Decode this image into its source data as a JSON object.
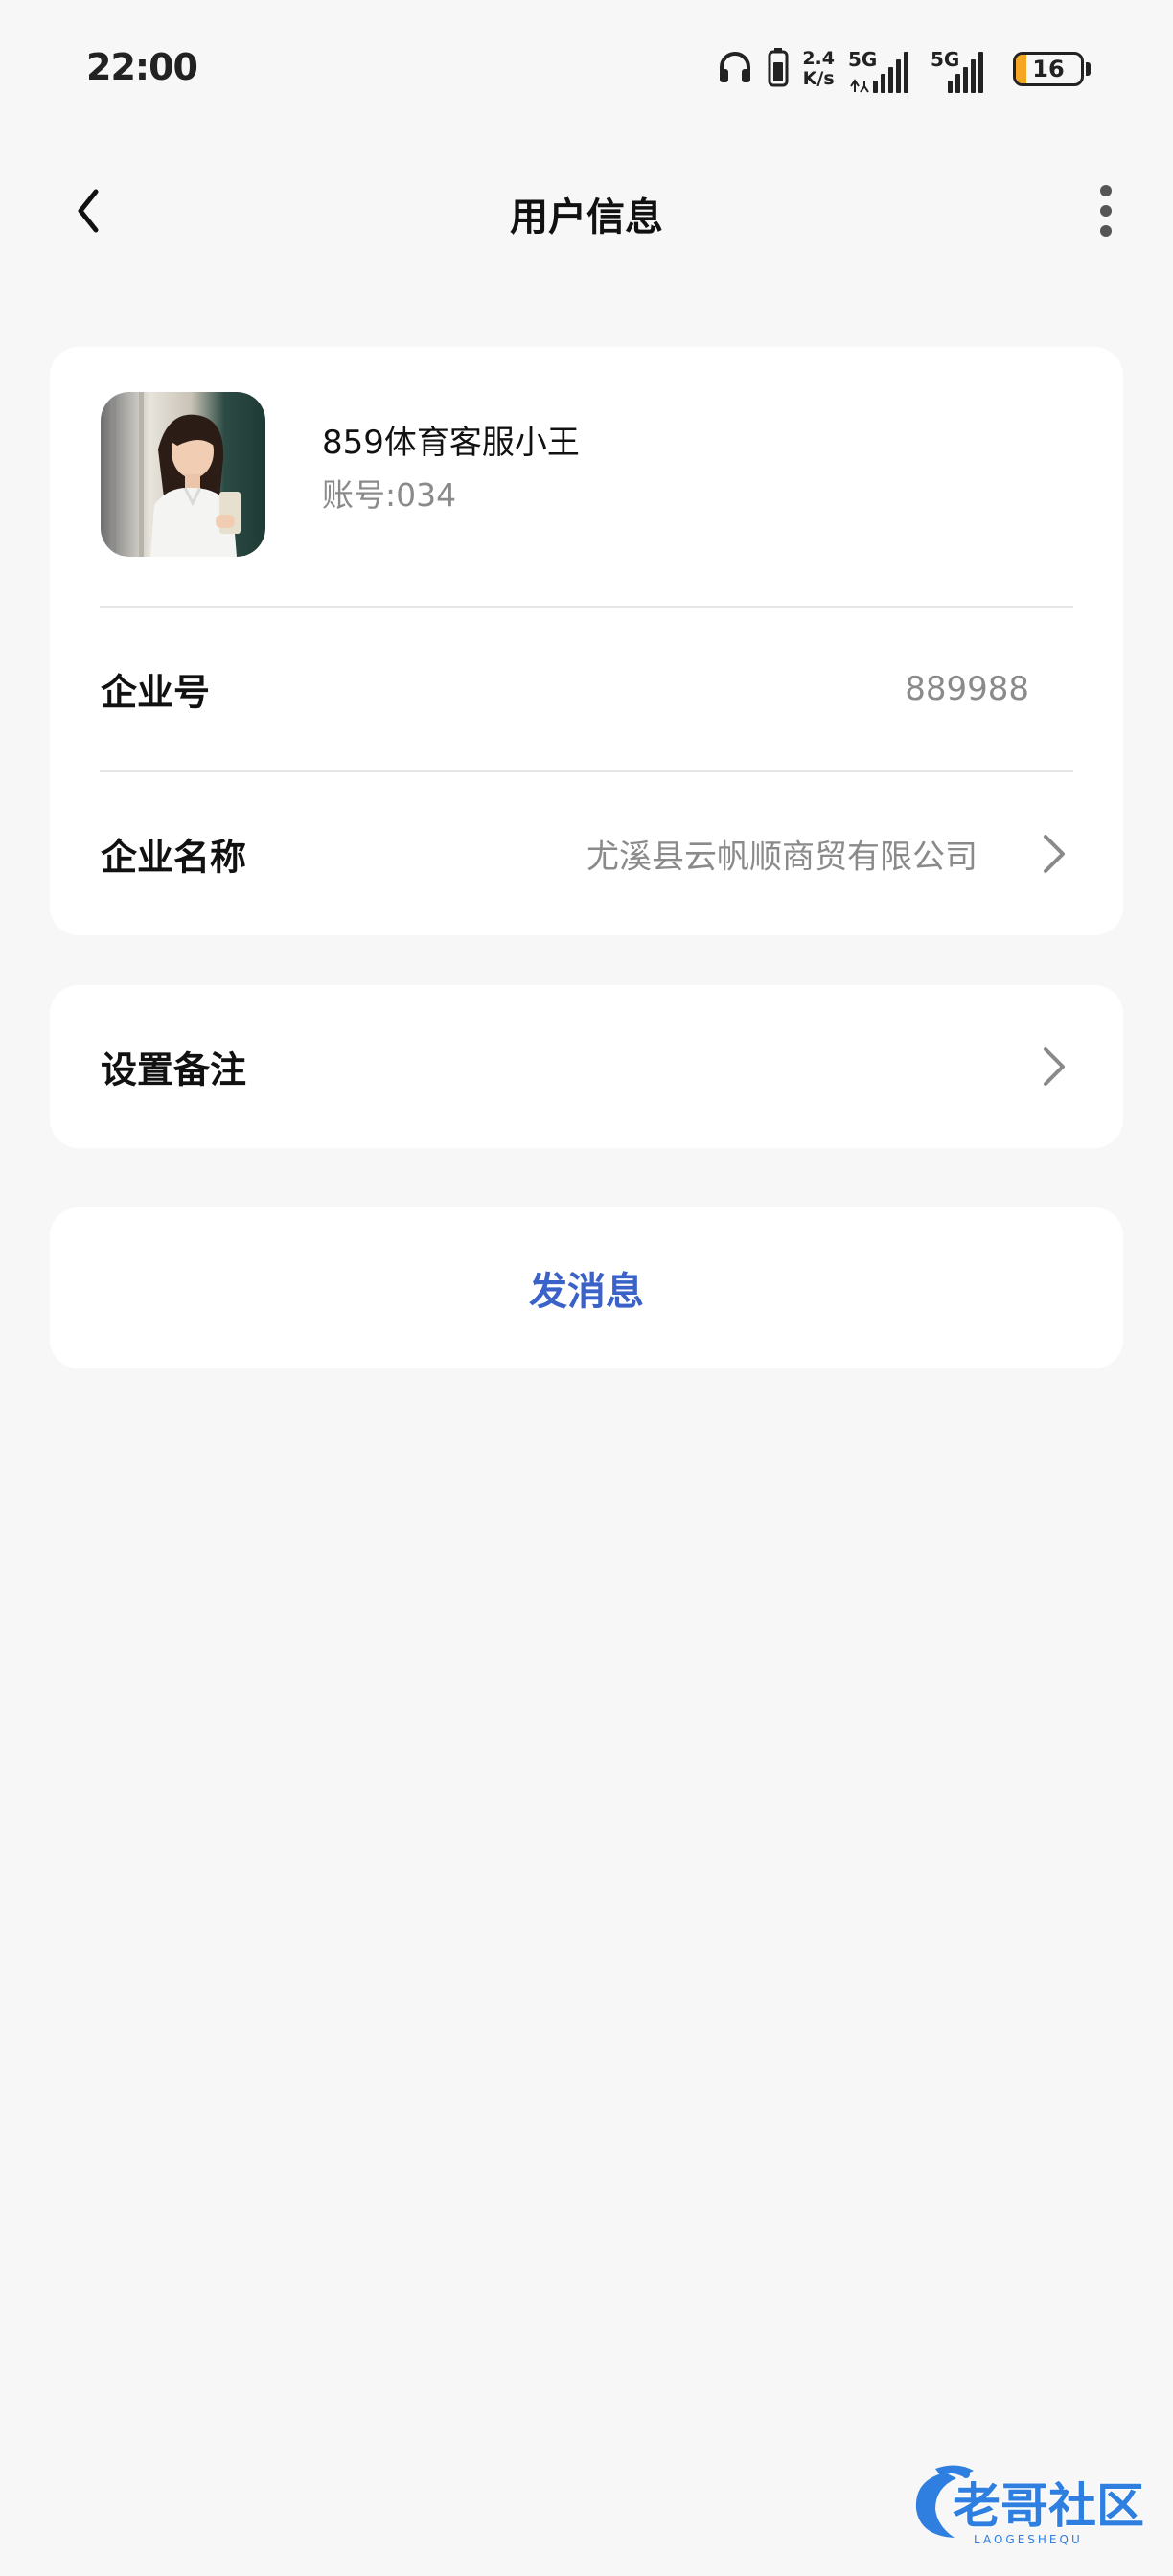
{
  "status_bar": {
    "time": "22:00",
    "net_speed_value": "2.4",
    "net_speed_unit": "K/s",
    "sim1_label": "5G",
    "sim2_label": "5G",
    "battery_level": "16",
    "battery_color": "#f5a623"
  },
  "nav": {
    "title": "用户信息",
    "back_icon": "chevron-left-icon",
    "more_icon": "more-vertical-icon"
  },
  "profile": {
    "name": "859体育客服小王",
    "account": "账号:034"
  },
  "info_rows": {
    "company_id_label": "企业号",
    "company_id_value": "889988",
    "company_name_label": "企业名称",
    "company_name_value": "尤溪县云帆顺商贸有限公司"
  },
  "remark": {
    "label": "设置备注"
  },
  "actions": {
    "send_message_label": "发消息",
    "accent_color": "#3a62c8"
  },
  "watermark": {
    "text": "老哥社区",
    "subtext": "LAOGESHEQU"
  }
}
